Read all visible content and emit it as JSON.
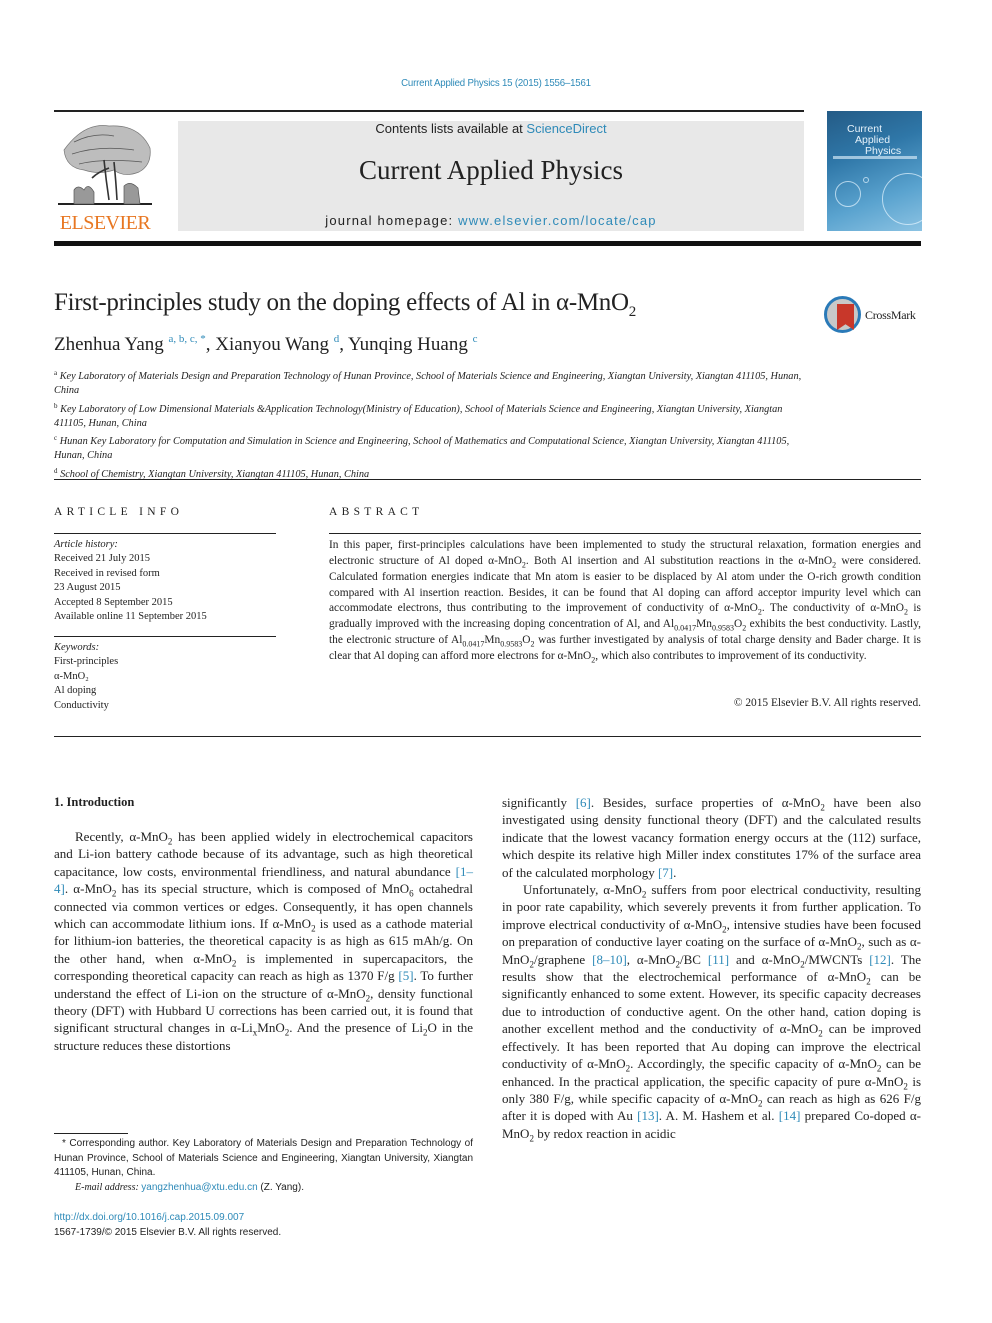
{
  "header": {
    "journal_ref": "Current Applied Physics 15 (2015) 1556–1561",
    "contents_prefix": "Contents lists available at ",
    "contents_link": "ScienceDirect",
    "journal_title": "Current Applied Physics",
    "homepage_prefix": "journal homepage: ",
    "homepage_link": "www.elsevier.com/locate/cap",
    "publisher_logo_text": "ELSEVIER",
    "cover": {
      "line1": "Current",
      "line2": "Applied",
      "line3": "Physics"
    },
    "colors": {
      "link": "#2e8ab8",
      "publisher_orange": "#e87722",
      "masthead_bg": "#e8e8e8"
    }
  },
  "article": {
    "title_main": "First-principles study on the doping effects of Al in α-MnO",
    "title_sub": "2",
    "crossmark_label": "CrossMark",
    "authors": [
      {
        "name": "Zhenhua Yang",
        "marks": "a, b, c, *",
        "sep": ", "
      },
      {
        "name": "Xianyou Wang",
        "marks": "d",
        "sep": ", "
      },
      {
        "name": "Yunqing Huang",
        "marks": "c",
        "sep": ""
      }
    ],
    "affiliations": [
      {
        "mark": "a",
        "text": "Key Laboratory of Materials Design and Preparation Technology of Hunan Province, School of Materials Science and Engineering, Xiangtan University, Xiangtan 411105, Hunan, China"
      },
      {
        "mark": "b",
        "text": "Key Laboratory of Low Dimensional Materials &Application Technology(Ministry of Education), School of Materials Science and Engineering, Xiangtan University, Xiangtan 411105, Hunan, China"
      },
      {
        "mark": "c",
        "text": "Hunan Key Laboratory for Computation and Simulation in Science and Engineering, School of Mathematics and Computational Science, Xiangtan University, Xiangtan 411105, Hunan, China"
      },
      {
        "mark": "d",
        "text": "School of Chemistry, Xiangtan University, Xiangtan 411105, Hunan, China"
      }
    ]
  },
  "article_info": {
    "heading": "ARTICLE INFO",
    "history_label": "Article history:",
    "history": [
      "Received 21 July 2015",
      "Received in revised form",
      "23 August 2015",
      "Accepted 8 September 2015",
      "Available online 11 September 2015"
    ],
    "keywords_label": "Keywords:",
    "keywords": [
      "First-principles",
      "α-MnO₂",
      "Al doping",
      "Conductivity"
    ]
  },
  "abstract": {
    "heading": "ABSTRACT",
    "t1": "In this paper, first-principles calculations have been implemented to study the structural relaxation, formation energies and electronic structure of Al doped α-MnO",
    "t2": ". Both Al insertion and Al substitution reactions in the α-MnO",
    "t3": " were considered. Calculated formation energies indicate that Mn atom is easier to be displaced by Al atom under the O-rich growth condition compared with Al insertion reaction. Besides, it can be found that Al doping can afford acceptor impurity level which can accommodate electrons, thus contributing to the improvement of conductivity of α-MnO",
    "t4": ". The conductivity of α-MnO",
    "t5": " is gradually improved with the increasing doping concentration of Al, and Al",
    "t6": "Mn",
    "t7": "O",
    "t8": " exhibits the best conductivity. Lastly, the electronic structure of Al",
    "t9": " was further investigated by analysis of total charge density and Bader charge. It is clear that Al doping can afford more electrons for α-MnO",
    "t10": ", which also contributes to improvement of its conductivity.",
    "sub2": "2",
    "sub_al": "0.0417",
    "sub_mn": "0.9583",
    "copyright": "© 2015 Elsevier B.V. All rights reserved."
  },
  "intro": {
    "heading": "1.  Introduction",
    "left": {
      "a": "Recently, α-MnO",
      "b": " has been applied widely in electrochemical capacitors and Li-ion battery cathode because of its advantage, such as high theoretical capacitance, low costs, environmental friendliness, and natural abundance ",
      "ref1": "[1–4]",
      "c": ". α-MnO",
      "d": " has its special structure, which is composed of MnO",
      "sub6": "6",
      "e": " octahedral connected via common vertices or edges. Consequently, it has open channels which can accommodate lithium ions. If α-MnO",
      "f": " is used as a cathode material for lithium-ion batteries, the theoretical capacity is as high as 615 mAh/g. On the other hand, when α-MnO",
      "g": " is implemented in supercapacitors, the corresponding theoretical capacity can reach as high as 1370 F/g ",
      "ref5": "[5]",
      "h": ". To further understand the effect of Li-ion on the structure of α-MnO",
      "i": ", density functional theory (DFT) with Hubbard U corrections has been carried out, it is found that significant structural changes in α-Li",
      "subx": "x",
      "j": "MnO",
      "k": ". And the presence of Li",
      "l": "O in the structure reduces these distortions"
    },
    "right": {
      "a": "significantly ",
      "ref6": "[6]",
      "b": ". Besides, surface properties of α-MnO",
      "c": " have been also investigated using density functional theory (DFT) and the calculated results indicate that the lowest vacancy formation energy occurs at the (112) surface, which despite its relative high Miller index constitutes 17% of the surface area of the calculated morphology ",
      "ref7": "[7]",
      "d": ".",
      "p2a": "Unfortunately, α-MnO",
      "p2b": " suffers from poor electrical conductivity, resulting in poor rate capability, which severely prevents it from further application. To improve electrical conductivity of α-MnO",
      "p2c": ", intensive studies have been focused on preparation of conductive layer coating on the surface of α-MnO",
      "p2d": ", such as α-MnO",
      "p2e": "/graphene ",
      "ref8": "[8–10]",
      "p2f": ", α-MnO",
      "p2g": "/BC ",
      "ref11": "[11]",
      "p2h": " and α-MnO",
      "p2i": "/MWCNTs ",
      "ref12": "[12]",
      "p2j": ". The results show that the electrochemical performance of α-MnO",
      "p2k": " can be significantly enhanced to some extent. However, its specific capacity decreases due to introduction of conductive agent. On the other hand, cation doping is another excellent method and the conductivity of α-MnO",
      "p2l": " can be improved effectively. It has been reported that Au doping can improve the electrical conductivity of α-MnO",
      "p2m": ". Accordingly, the specific capacity of α-MnO",
      "p2n": " can be enhanced. In the practical application, the specific capacity of pure α-MnO",
      "p2o": " is only 380 F/g, while specific capacity of α-MnO",
      "p2p": " can reach as high as 626 F/g after it is doped with Au ",
      "ref13": "[13]",
      "p2q": ". A. M. Hashem et al. ",
      "ref14": "[14]",
      "p2r": " prepared Co-doped α-MnO",
      "p2s": " by redox reaction in acidic"
    }
  },
  "footnote": {
    "text": "* Corresponding author. Key Laboratory of Materials Design and Preparation Technology of Hunan Province, School of Materials Science and Engineering, Xiangtan University, Xiangtan 411105, Hunan, China.",
    "email_label": "E-mail address: ",
    "email": "yangzhenhua@xtu.edu.cn",
    "email_suffix": " (Z. Yang).",
    "doi": "http://dx.doi.org/10.1016/j.cap.2015.09.007",
    "issn": "1567-1739/© 2015 Elsevier B.V. All rights reserved."
  }
}
